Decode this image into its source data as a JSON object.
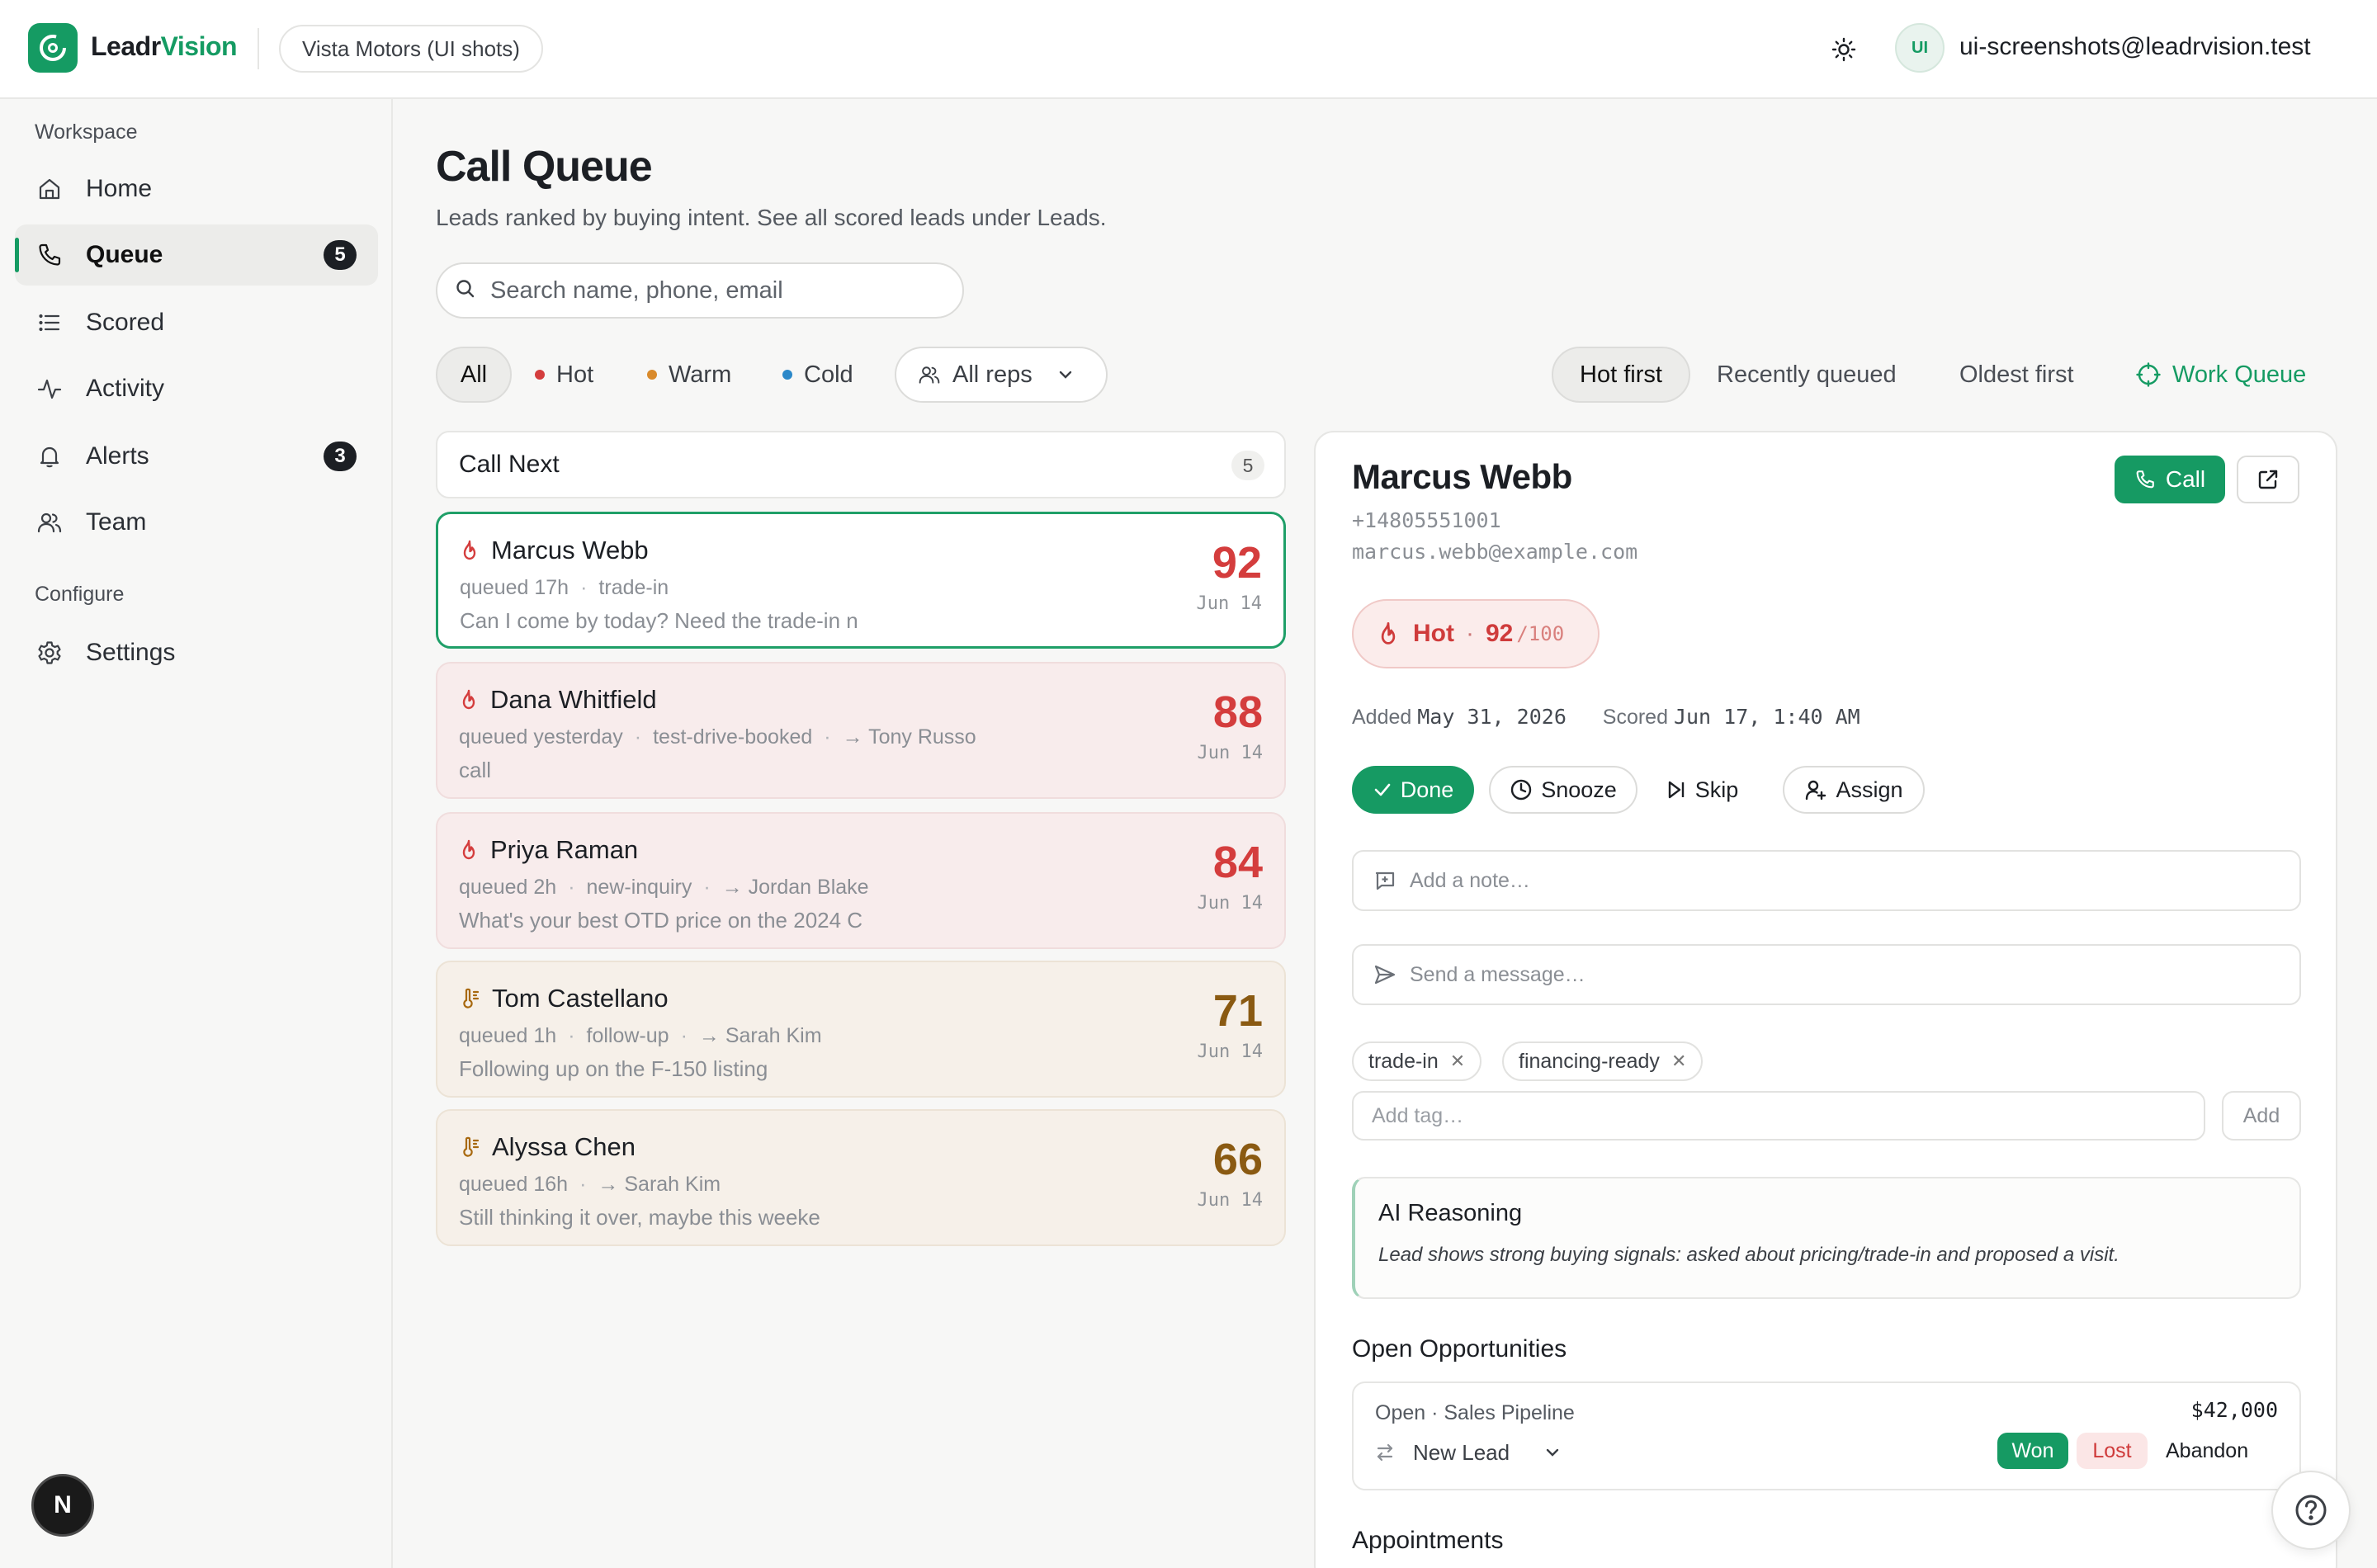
{
  "app": {
    "brand_part1": "Leadr",
    "brand_part2": "Vision",
    "org": "Vista Motors (UI shots)",
    "avatar_initials": "UI",
    "user_email": "ui-screenshots@leadrvision.test",
    "accent_color": "#159b63"
  },
  "sidebar": {
    "workspace_label": "Workspace",
    "configure_label": "Configure",
    "items": [
      {
        "label": "Home",
        "icon": "home-icon"
      },
      {
        "label": "Queue",
        "icon": "phone-icon",
        "badge": "5",
        "active": true
      },
      {
        "label": "Scored",
        "icon": "list-icon"
      },
      {
        "label": "Activity",
        "icon": "activity-icon"
      },
      {
        "label": "Alerts",
        "icon": "bell-icon",
        "badge": "3"
      },
      {
        "label": "Team",
        "icon": "users-icon"
      }
    ],
    "settings_label": "Settings",
    "bottom_bubble": "N"
  },
  "main": {
    "title": "Call Queue",
    "subtitle": "Leads ranked by buying intent. See all scored leads under Leads.",
    "search_placeholder": "Search name, phone, email",
    "filters": {
      "all": "All",
      "hot": "Hot",
      "warm": "Warm",
      "cold": "Cold",
      "reps": "All reps",
      "hot_color": "#d43d3d",
      "warm_color": "#d98a2b",
      "cold_color": "#2b88c9"
    },
    "sort": {
      "hot_first": "Hot first",
      "recently_queued": "Recently queued",
      "oldest_first": "Oldest first",
      "work_queue": "Work Queue"
    }
  },
  "list": {
    "header": "Call Next",
    "count": "5",
    "leads": [
      {
        "name": "Marcus Webb",
        "queued": "queued 17h",
        "tag": "trade-in",
        "rep": "",
        "preview": "Can I come by today? Need the trade-in n",
        "score": "92",
        "date": "Jun 14",
        "temp": "hot"
      },
      {
        "name": "Dana Whitfield",
        "queued": "queued yesterday",
        "tag": "test-drive-booked",
        "rep": "→ Tony Russo",
        "preview": "call",
        "score": "88",
        "date": "Jun 14",
        "temp": "hot"
      },
      {
        "name": "Priya Raman",
        "queued": "queued 2h",
        "tag": "new-inquiry",
        "rep": "→ Jordan Blake",
        "preview": "What's your best OTD price on the 2024 C",
        "score": "84",
        "date": "Jun 14",
        "temp": "hot"
      },
      {
        "name": "Tom Castellano",
        "queued": "queued 1h",
        "tag": "follow-up",
        "rep": "→ Sarah Kim",
        "preview": "Following up on the F-150 listing",
        "score": "71",
        "date": "Jun 14",
        "temp": "warm"
      },
      {
        "name": "Alyssa Chen",
        "queued": "queued 16h",
        "tag": "",
        "rep": "→ Sarah Kim",
        "preview": "Still thinking it over, maybe this weeke",
        "score": "66",
        "date": "Jun 14",
        "temp": "warm"
      }
    ]
  },
  "detail": {
    "name": "Marcus Webb",
    "phone": "+14805551001",
    "email": "marcus.webb@example.com",
    "call_label": "Call",
    "temp_label": "Hot",
    "score": "92",
    "score_den": "/100",
    "added_label": "Added",
    "added_value": "May 31, 2026",
    "scored_label": "Scored",
    "scored_value": "Jun 17, 1:40 AM",
    "actions": {
      "done": "Done",
      "snooze": "Snooze",
      "skip": "Skip",
      "assign": "Assign"
    },
    "note_placeholder": "Add a note…",
    "message_placeholder": "Send a message…",
    "tags": [
      "trade-in",
      "financing-ready"
    ],
    "tag_placeholder": "Add tag…",
    "tag_add": "Add",
    "ai_title": "AI Reasoning",
    "ai_text": "Lead shows strong buying signals: asked about pricing/trade-in and proposed a visit.",
    "opportunities_title": "Open Opportunities",
    "opportunity": {
      "title": "Open · Sales Pipeline",
      "stage": "New Lead",
      "amount": "$42,000",
      "won": "Won",
      "lost": "Lost",
      "abandon": "Abandon"
    },
    "appointments_title": "Appointments"
  }
}
